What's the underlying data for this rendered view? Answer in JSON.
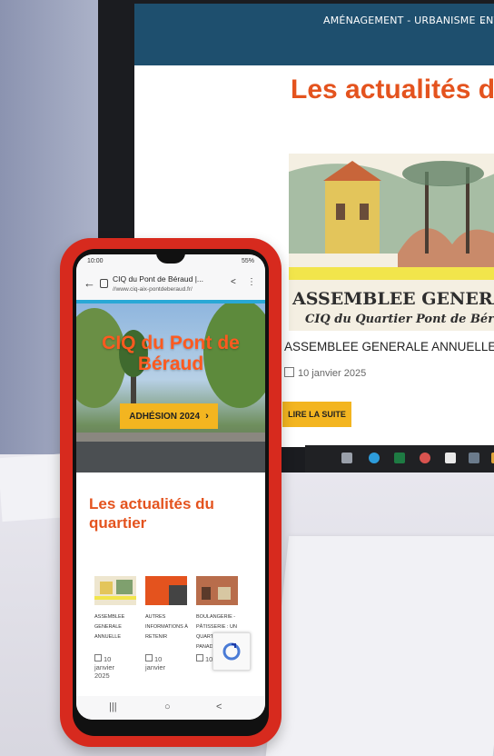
{
  "monitor": {
    "nav": {
      "item1": "AMÉNAGEMENT - URBANISME",
      "item2": "ENV"
    },
    "heading": "Les actualités du qu",
    "artwork_text": {
      "line1": "ASSEMBLEE GENERA",
      "line2": "CIQ du Quartier Pont de Béra"
    },
    "article_title": "ASSEMBLEE GENERALE ANNUELLE",
    "article_date": "10 janvier 2025",
    "read_more": "LIRE LA SUITE"
  },
  "phone": {
    "status": {
      "time": "10:00",
      "battery": "55%"
    },
    "browser": {
      "page_title": "CIQ du Pont de Béraud |...",
      "url": "//www.ciq-aix-pontdeberaud.fr/"
    },
    "hero": {
      "title_line1": "CIQ du Pont de",
      "title_line2": "Béraud",
      "button": "ADHÉSION 2024"
    },
    "section_title": "Les actualités du quartier",
    "articles": [
      {
        "label": "ASSEMBLEE GENERALE ANNUELLE",
        "date": "10 janvier 2025"
      },
      {
        "label": "AUTRES INFORMATIONS À RETENIR",
        "date": "10 janvier"
      },
      {
        "label": "BOULANGERIE - PÂTISSERIE : UN QUARTIER ... LA PANAD",
        "date": "10"
      }
    ]
  },
  "colors": {
    "accent": "#e4531e",
    "button": "#f3b520",
    "phone_case": "#d72a1e",
    "nav": "#1e4f6e"
  }
}
